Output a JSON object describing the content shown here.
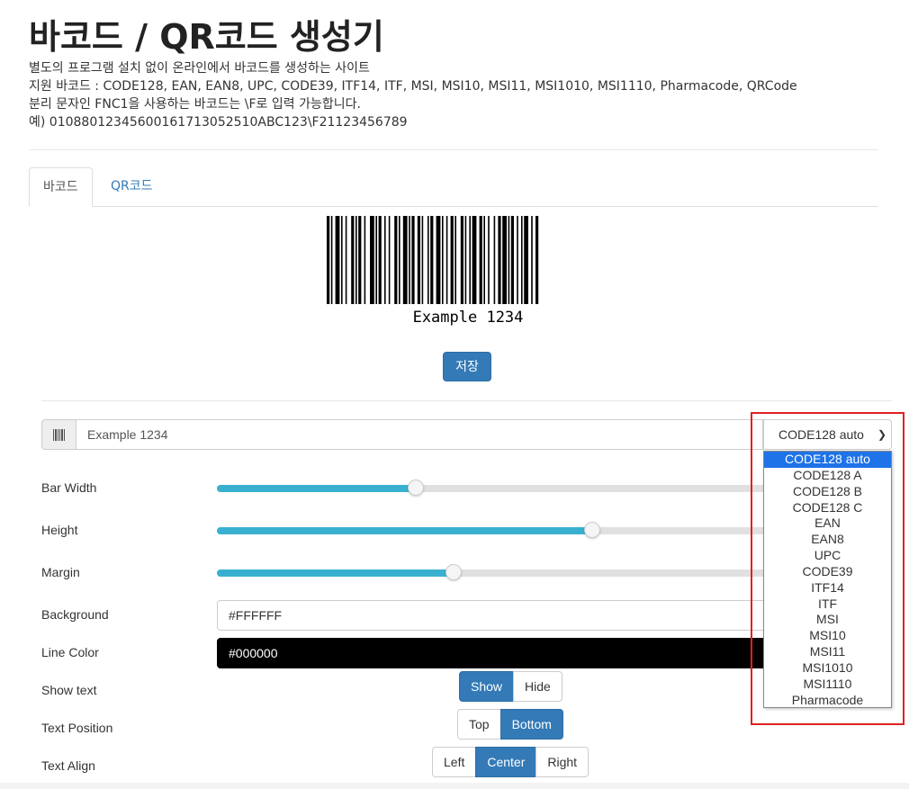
{
  "header": {
    "title": "바코드 / QR코드 생성기",
    "desc_lines": [
      "별도의 프로그램 설치 없이 온라인에서 바코드를 생성하는 사이트",
      "지원 바코드 : CODE128, EAN, EAN8, UPC, CODE39, ITF14, ITF, MSI, MSI10, MSI11, MSI1010, MSI1110, Pharmacode, QRCode",
      "분리 문자인 FNC1을 사용하는 바코드는 \\F로 입력 가능합니다.",
      "예) 0108801234560016171305251 0ABC123\\F21123456789"
    ]
  },
  "tabs": [
    {
      "label": "바코드",
      "active": true
    },
    {
      "label": "QR코드",
      "active": false
    }
  ],
  "barcode": {
    "text": "Example 1234"
  },
  "save_button": "저장",
  "input": {
    "value": "Example 1234",
    "icon": "barcode-icon"
  },
  "format_select": {
    "selected": "CODE128 auto",
    "options": [
      "CODE128 auto",
      "CODE128 A",
      "CODE128 B",
      "CODE128 C",
      "EAN",
      "EAN8",
      "UPC",
      "CODE39",
      "ITF14",
      "ITF",
      "MSI",
      "MSI10",
      "MSI11",
      "MSI1010",
      "MSI1110",
      "Pharmacode"
    ]
  },
  "settings": {
    "bar_width": {
      "label": "Bar Width",
      "fraction": 0.357
    },
    "height": {
      "label": "Height",
      "fraction": 0.673
    },
    "margin": {
      "label": "Margin",
      "fraction": 0.424
    },
    "background": {
      "label": "Background",
      "value": "#FFFFFF"
    },
    "line_color": {
      "label": "Line Color",
      "value": "#000000"
    },
    "show_text": {
      "label": "Show text",
      "options": [
        "Show",
        "Hide"
      ],
      "selected": "Show"
    },
    "text_position": {
      "label": "Text Position",
      "options": [
        "Top",
        "Bottom"
      ],
      "selected": "Bottom"
    },
    "text_align": {
      "label": "Text Align",
      "options": [
        "Left",
        "Center",
        "Right"
      ],
      "selected": "Center"
    }
  },
  "colors": {
    "primary": "#337ab7",
    "slider_fill": "#3ab0d0",
    "dropdown_selected": "#1e73e8",
    "highlight": "#e02020"
  }
}
